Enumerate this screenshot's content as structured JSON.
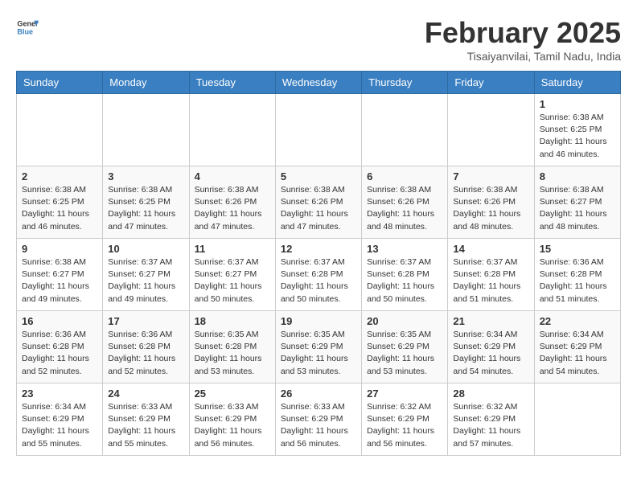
{
  "header": {
    "logo_general": "General",
    "logo_blue": "Blue",
    "title": "February 2025",
    "subtitle": "Tisaiyanvilai, Tamil Nadu, India"
  },
  "weekdays": [
    "Sunday",
    "Monday",
    "Tuesday",
    "Wednesday",
    "Thursday",
    "Friday",
    "Saturday"
  ],
  "weeks": [
    [
      {
        "day": "",
        "info": ""
      },
      {
        "day": "",
        "info": ""
      },
      {
        "day": "",
        "info": ""
      },
      {
        "day": "",
        "info": ""
      },
      {
        "day": "",
        "info": ""
      },
      {
        "day": "",
        "info": ""
      },
      {
        "day": "1",
        "info": "Sunrise: 6:38 AM\nSunset: 6:25 PM\nDaylight: 11 hours\nand 46 minutes."
      }
    ],
    [
      {
        "day": "2",
        "info": "Sunrise: 6:38 AM\nSunset: 6:25 PM\nDaylight: 11 hours\nand 46 minutes."
      },
      {
        "day": "3",
        "info": "Sunrise: 6:38 AM\nSunset: 6:25 PM\nDaylight: 11 hours\nand 47 minutes."
      },
      {
        "day": "4",
        "info": "Sunrise: 6:38 AM\nSunset: 6:26 PM\nDaylight: 11 hours\nand 47 minutes."
      },
      {
        "day": "5",
        "info": "Sunrise: 6:38 AM\nSunset: 6:26 PM\nDaylight: 11 hours\nand 47 minutes."
      },
      {
        "day": "6",
        "info": "Sunrise: 6:38 AM\nSunset: 6:26 PM\nDaylight: 11 hours\nand 48 minutes."
      },
      {
        "day": "7",
        "info": "Sunrise: 6:38 AM\nSunset: 6:26 PM\nDaylight: 11 hours\nand 48 minutes."
      },
      {
        "day": "8",
        "info": "Sunrise: 6:38 AM\nSunset: 6:27 PM\nDaylight: 11 hours\nand 48 minutes."
      }
    ],
    [
      {
        "day": "9",
        "info": "Sunrise: 6:38 AM\nSunset: 6:27 PM\nDaylight: 11 hours\nand 49 minutes."
      },
      {
        "day": "10",
        "info": "Sunrise: 6:37 AM\nSunset: 6:27 PM\nDaylight: 11 hours\nand 49 minutes."
      },
      {
        "day": "11",
        "info": "Sunrise: 6:37 AM\nSunset: 6:27 PM\nDaylight: 11 hours\nand 50 minutes."
      },
      {
        "day": "12",
        "info": "Sunrise: 6:37 AM\nSunset: 6:28 PM\nDaylight: 11 hours\nand 50 minutes."
      },
      {
        "day": "13",
        "info": "Sunrise: 6:37 AM\nSunset: 6:28 PM\nDaylight: 11 hours\nand 50 minutes."
      },
      {
        "day": "14",
        "info": "Sunrise: 6:37 AM\nSunset: 6:28 PM\nDaylight: 11 hours\nand 51 minutes."
      },
      {
        "day": "15",
        "info": "Sunrise: 6:36 AM\nSunset: 6:28 PM\nDaylight: 11 hours\nand 51 minutes."
      }
    ],
    [
      {
        "day": "16",
        "info": "Sunrise: 6:36 AM\nSunset: 6:28 PM\nDaylight: 11 hours\nand 52 minutes."
      },
      {
        "day": "17",
        "info": "Sunrise: 6:36 AM\nSunset: 6:28 PM\nDaylight: 11 hours\nand 52 minutes."
      },
      {
        "day": "18",
        "info": "Sunrise: 6:35 AM\nSunset: 6:28 PM\nDaylight: 11 hours\nand 53 minutes."
      },
      {
        "day": "19",
        "info": "Sunrise: 6:35 AM\nSunset: 6:29 PM\nDaylight: 11 hours\nand 53 minutes."
      },
      {
        "day": "20",
        "info": "Sunrise: 6:35 AM\nSunset: 6:29 PM\nDaylight: 11 hours\nand 53 minutes."
      },
      {
        "day": "21",
        "info": "Sunrise: 6:34 AM\nSunset: 6:29 PM\nDaylight: 11 hours\nand 54 minutes."
      },
      {
        "day": "22",
        "info": "Sunrise: 6:34 AM\nSunset: 6:29 PM\nDaylight: 11 hours\nand 54 minutes."
      }
    ],
    [
      {
        "day": "23",
        "info": "Sunrise: 6:34 AM\nSunset: 6:29 PM\nDaylight: 11 hours\nand 55 minutes."
      },
      {
        "day": "24",
        "info": "Sunrise: 6:33 AM\nSunset: 6:29 PM\nDaylight: 11 hours\nand 55 minutes."
      },
      {
        "day": "25",
        "info": "Sunrise: 6:33 AM\nSunset: 6:29 PM\nDaylight: 11 hours\nand 56 minutes."
      },
      {
        "day": "26",
        "info": "Sunrise: 6:33 AM\nSunset: 6:29 PM\nDaylight: 11 hours\nand 56 minutes."
      },
      {
        "day": "27",
        "info": "Sunrise: 6:32 AM\nSunset: 6:29 PM\nDaylight: 11 hours\nand 56 minutes."
      },
      {
        "day": "28",
        "info": "Sunrise: 6:32 AM\nSunset: 6:29 PM\nDaylight: 11 hours\nand 57 minutes."
      },
      {
        "day": "",
        "info": ""
      }
    ]
  ]
}
